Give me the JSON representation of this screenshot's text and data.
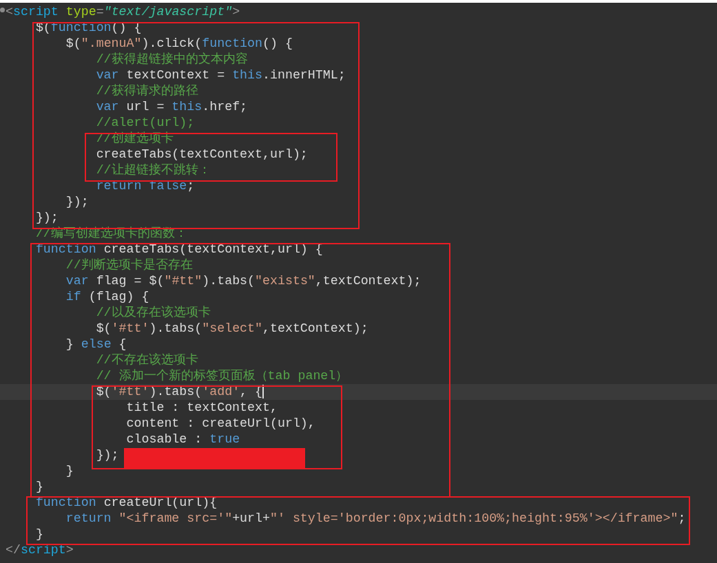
{
  "editor": {
    "lines": [
      {
        "current": false,
        "tokens": [
          {
            "kind": "punct",
            "text": "<"
          },
          {
            "kind": "tag",
            "text": "script"
          },
          {
            "kind": "attr",
            "text": " type"
          },
          {
            "kind": "punct",
            "text": "="
          },
          {
            "kind": "value",
            "text": "\"text/javascript\""
          },
          {
            "kind": "punct",
            "text": ">"
          }
        ]
      },
      {
        "current": false,
        "tokens": [
          {
            "kind": "plain",
            "text": "    $("
          },
          {
            "kind": "keyword",
            "text": "function"
          },
          {
            "kind": "plain",
            "text": "() {"
          }
        ]
      },
      {
        "current": false,
        "tokens": [
          {
            "kind": "plain",
            "text": "        $("
          },
          {
            "kind": "string",
            "text": "\".menuA\""
          },
          {
            "kind": "plain",
            "text": ").click("
          },
          {
            "kind": "keyword",
            "text": "function"
          },
          {
            "kind": "plain",
            "text": "() {"
          }
        ]
      },
      {
        "current": false,
        "tokens": [
          {
            "kind": "comment",
            "text": "            //获得超链接中的文本内容"
          }
        ]
      },
      {
        "current": false,
        "tokens": [
          {
            "kind": "keyword",
            "text": "            var"
          },
          {
            "kind": "plain",
            "text": " textContext = "
          },
          {
            "kind": "keyword",
            "text": "this"
          },
          {
            "kind": "plain",
            "text": ".innerHTML;"
          }
        ]
      },
      {
        "current": false,
        "tokens": [
          {
            "kind": "comment",
            "text": "            //获得请求的路径"
          }
        ]
      },
      {
        "current": false,
        "tokens": [
          {
            "kind": "keyword",
            "text": "            var"
          },
          {
            "kind": "plain",
            "text": " url = "
          },
          {
            "kind": "keyword",
            "text": "this"
          },
          {
            "kind": "plain",
            "text": ".href;"
          }
        ]
      },
      {
        "current": false,
        "tokens": [
          {
            "kind": "comment",
            "text": "            //alert(url);"
          }
        ]
      },
      {
        "current": false,
        "tokens": [
          {
            "kind": "comment",
            "text": "            //创建选项卡"
          }
        ]
      },
      {
        "current": false,
        "tokens": [
          {
            "kind": "plain",
            "text": "            createTabs(textContext,url);"
          }
        ]
      },
      {
        "current": false,
        "tokens": [
          {
            "kind": "comment",
            "text": "            //让超链接不跳转："
          }
        ]
      },
      {
        "current": false,
        "tokens": [
          {
            "kind": "keyword",
            "text": "            return false"
          },
          {
            "kind": "plain",
            "text": ";"
          }
        ]
      },
      {
        "current": false,
        "tokens": [
          {
            "kind": "plain",
            "text": "        });"
          }
        ]
      },
      {
        "current": false,
        "tokens": [
          {
            "kind": "plain",
            "text": "    });"
          }
        ]
      },
      {
        "current": false,
        "tokens": [
          {
            "kind": "comment",
            "text": "    //编写创建选项卡的函数："
          }
        ]
      },
      {
        "current": false,
        "tokens": [
          {
            "kind": "keyword",
            "text": "    function"
          },
          {
            "kind": "plain",
            "text": " createTabs(textContext,url) {"
          }
        ]
      },
      {
        "current": false,
        "tokens": [
          {
            "kind": "comment",
            "text": "        //判断选项卡是否存在"
          }
        ]
      },
      {
        "current": false,
        "tokens": [
          {
            "kind": "keyword",
            "text": "        var"
          },
          {
            "kind": "plain",
            "text": " flag = $("
          },
          {
            "kind": "string",
            "text": "\"#tt\""
          },
          {
            "kind": "plain",
            "text": ").tabs("
          },
          {
            "kind": "string",
            "text": "\"exists\""
          },
          {
            "kind": "plain",
            "text": ",textContext);"
          }
        ]
      },
      {
        "current": false,
        "tokens": [
          {
            "kind": "keyword",
            "text": "        if"
          },
          {
            "kind": "plain",
            "text": " (flag) {"
          }
        ]
      },
      {
        "current": false,
        "tokens": [
          {
            "kind": "comment",
            "text": "            //以及存在该选项卡"
          }
        ]
      },
      {
        "current": false,
        "tokens": [
          {
            "kind": "plain",
            "text": "            $("
          },
          {
            "kind": "string",
            "text": "'#tt'"
          },
          {
            "kind": "plain",
            "text": ").tabs("
          },
          {
            "kind": "string",
            "text": "\"select\""
          },
          {
            "kind": "plain",
            "text": ",textContext);"
          }
        ]
      },
      {
        "current": false,
        "tokens": [
          {
            "kind": "plain",
            "text": "        } "
          },
          {
            "kind": "keyword",
            "text": "else"
          },
          {
            "kind": "plain",
            "text": " {"
          }
        ]
      },
      {
        "current": false,
        "tokens": [
          {
            "kind": "comment",
            "text": "            //不存在该选项卡"
          }
        ]
      },
      {
        "current": false,
        "tokens": [
          {
            "kind": "comment",
            "text": "            // 添加一个新的标签页面板（tab panel）"
          }
        ]
      },
      {
        "current": true,
        "tokens": [
          {
            "kind": "plain",
            "text": "            $("
          },
          {
            "kind": "string",
            "text": "'#tt'"
          },
          {
            "kind": "plain",
            "text": ").tabs("
          },
          {
            "kind": "string",
            "text": "'add'"
          },
          {
            "kind": "plain",
            "text": ", {"
          }
        ]
      },
      {
        "current": false,
        "tokens": [
          {
            "kind": "plain",
            "text": "                title : textContext,"
          }
        ]
      },
      {
        "current": false,
        "tokens": [
          {
            "kind": "plain",
            "text": "                content : createUrl(url),"
          }
        ]
      },
      {
        "current": false,
        "tokens": [
          {
            "kind": "plain",
            "text": "                closable : "
          },
          {
            "kind": "keyword",
            "text": "true"
          }
        ]
      },
      {
        "current": false,
        "tokens": [
          {
            "kind": "plain",
            "text": "            });"
          }
        ]
      },
      {
        "current": false,
        "tokens": [
          {
            "kind": "plain",
            "text": "        }"
          }
        ]
      },
      {
        "current": false,
        "tokens": [
          {
            "kind": "plain",
            "text": "    }"
          }
        ]
      },
      {
        "current": false,
        "tokens": [
          {
            "kind": "keyword",
            "text": "    function"
          },
          {
            "kind": "plain",
            "text": " createUrl(url){"
          }
        ]
      },
      {
        "current": false,
        "tokens": [
          {
            "kind": "keyword",
            "text": "        return"
          },
          {
            "kind": "string",
            "text": " \"<iframe src='\""
          },
          {
            "kind": "plain",
            "text": "+url+"
          },
          {
            "kind": "string",
            "text": "\"' style='border:0px;width:100%;height:95%'></iframe>\""
          },
          {
            "kind": "plain",
            "text": ";"
          }
        ]
      },
      {
        "current": false,
        "tokens": [
          {
            "kind": "plain",
            "text": "    }"
          }
        ]
      },
      {
        "current": false,
        "tokens": [
          {
            "kind": "punct",
            "text": "</"
          },
          {
            "kind": "tag",
            "text": "script"
          },
          {
            "kind": "punct",
            "text": ">"
          }
        ]
      }
    ]
  }
}
